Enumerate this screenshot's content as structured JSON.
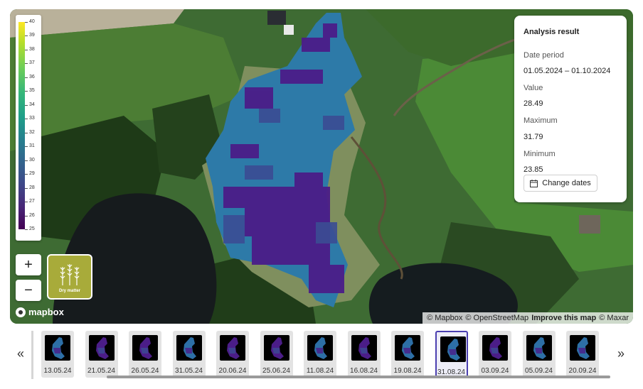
{
  "legend": {
    "ticks": [
      "40",
      "39",
      "38",
      "37",
      "36",
      "35",
      "34",
      "33",
      "32",
      "31",
      "30",
      "29",
      "28",
      "27",
      "26",
      "25"
    ]
  },
  "zoom": {
    "in_label": "+",
    "out_label": "−"
  },
  "layer": {
    "label": "Dry matter",
    "icon": "wheat-icon"
  },
  "map": {
    "logo_text": "mapbox",
    "attribution": {
      "mapbox": "© Mapbox",
      "osm": "© OpenStreetMap",
      "improve": "Improve this map",
      "maxar": "© Maxar"
    }
  },
  "panel": {
    "title": "Analysis result",
    "date_label": "Date period",
    "date_value": "01.05.2024 – 01.10.2024",
    "value_label": "Value",
    "value": "28.49",
    "max_label": "Maximum",
    "max_value": "31.79",
    "min_label": "Minimum",
    "min_value": "23.85",
    "button_label": "Change dates"
  },
  "timeline": {
    "prev": "«",
    "next": "»",
    "selected_index": 9,
    "dates": [
      "13.05.24",
      "21.05.24",
      "26.05.24",
      "31.05.24",
      "20.06.24",
      "25.06.24",
      "11.08.24",
      "16.08.24",
      "19.08.24",
      "31.08.24",
      "03.09.24",
      "05.09.24",
      "20.09.24"
    ]
  },
  "colors": {
    "accent": "#4b3fb0",
    "layer_tile": "#a8ab3a",
    "field_low": "#4b1d88",
    "field_high": "#2d7aa8"
  }
}
